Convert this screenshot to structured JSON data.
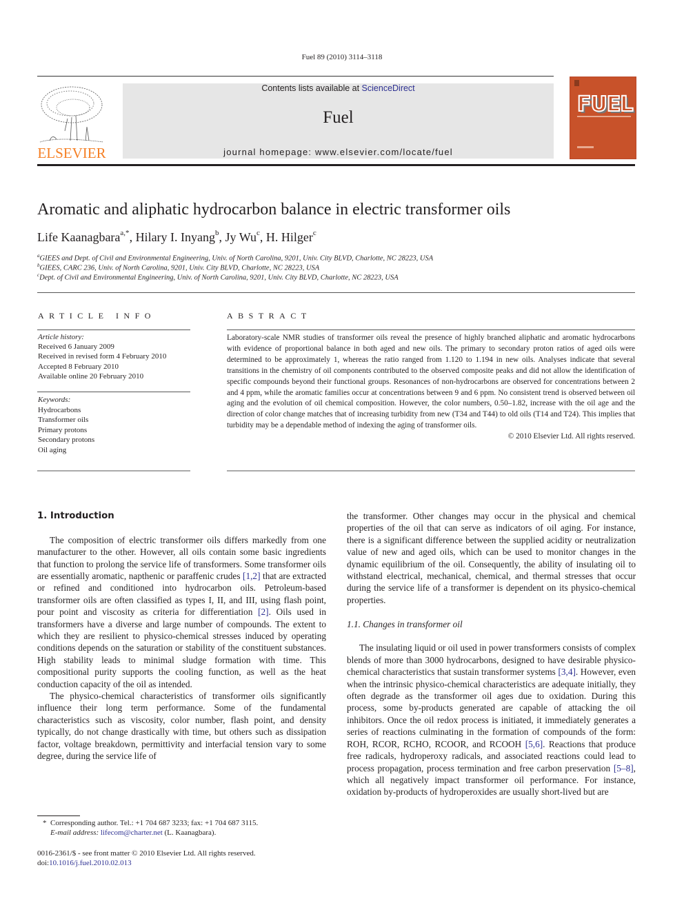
{
  "running_head": "Fuel 89 (2010) 3114–3118",
  "banner": {
    "contents_prefix": "Contents lists available at ",
    "contents_link": "ScienceDirect",
    "journal_title": "Fuel",
    "homepage": "journal homepage: www.elsevier.com/locate/fuel"
  },
  "publisher": {
    "logo_text": "ELSEVIER",
    "brand_color": "#f58025"
  },
  "cover": {
    "title": "FUEL",
    "color": "#c8522a"
  },
  "article": {
    "title": "Aromatic and aliphatic hydrocarbon balance in electric transformer oils",
    "authors": [
      {
        "name": "Life Kaanagbara",
        "sup": "a,*",
        "sep": ", "
      },
      {
        "name": "Hilary I. Inyang",
        "sup": "b",
        "sep": ", "
      },
      {
        "name": "Jy Wu",
        "sup": "c",
        "sep": ", "
      },
      {
        "name": "H. Hilger",
        "sup": "c",
        "sep": ""
      }
    ],
    "affiliations": [
      {
        "sup": "a",
        "text": "GIEES and Dept. of Civil and Environmental Engineering, Univ. of North Carolina, 9201, Univ. City BLVD, Charlotte, NC 28223, USA"
      },
      {
        "sup": "b",
        "text": "GIEES, CARC 236, Univ. of North Carolina, 9201, Univ. City BLVD, Charlotte, NC 28223, USA"
      },
      {
        "sup": "c",
        "text": "Dept. of Civil and Environmental Engineering, Univ. of North Carolina, 9201, Univ. City BLVD, Charlotte, NC 28223, USA"
      }
    ]
  },
  "article_info": {
    "heading": "ARTICLE INFO",
    "history_label": "Article history:",
    "history": [
      "Received 6 January 2009",
      "Received in revised form 4 February 2010",
      "Accepted 8 February 2010",
      "Available online 20 February 2010"
    ],
    "keywords_label": "Keywords:",
    "keywords": [
      "Hydrocarbons",
      "Transformer oils",
      "Primary protons",
      "Secondary protons",
      "Oil aging"
    ]
  },
  "abstract": {
    "heading": "ABSTRACT",
    "text": "Laboratory-scale NMR studies of transformer oils reveal the presence of highly branched aliphatic and aromatic hydrocarbons with evidence of proportional balance in both aged and new oils. The primary to secondary proton ratios of aged oils were determined to be approximately 1, whereas the ratio ranged from 1.120 to 1.194 in new oils. Analyses indicate that several transitions in the chemistry of oil components contributed to the observed composite peaks and did not allow the identification of specific compounds beyond their functional groups. Resonances of non-hydrocarbons are observed for concentrations between 2 and 4 ppm, while the aromatic families occur at concentrations between 9 and 6 ppm. No consistent trend is observed between oil aging and the evolution of oil chemical composition. However, the color numbers, 0.50–1.82, increase with the oil age and the direction of color change matches that of increasing turbidity from new (T34 and T44) to old oils (T14 and T24). This implies that turbidity may be a dependable method of indexing the aging of transformer oils.",
    "copyright": "© 2010 Elsevier Ltd. All rights reserved."
  },
  "body": {
    "intro_heading": "1. Introduction",
    "p1": [
      {
        "t": "The composition of electric transformer oils differs markedly from one manufacturer to the other. However, all oils contain some basic ingredients that function to prolong the service life of transformers. Some transformer oils are essentially aromatic, napthenic or paraffenic crudes "
      },
      {
        "ref": "[1,2]"
      },
      {
        "t": " that are extracted or refined and conditioned into hydrocarbon oils. Petroleum-based transformer oils are often classified as types I, II, and III, using flash point, pour point and viscosity as criteria for differentiation "
      },
      {
        "ref": "[2]"
      },
      {
        "t": ". Oils used in transformers have a diverse and large number of compounds. The extent to which they are resilient to physico-chemical stresses induced by operating conditions depends on the saturation or stability of the constituent substances. High stability leads to minimal sludge formation with time. This compositional purity supports the cooling function, as well as the heat conduction capacity of the oil as intended."
      }
    ],
    "p2": [
      {
        "t": "The physico-chemical characteristics of transformer oils significantly influence their long term performance. Some of the fundamental characteristics such as viscosity, color number, flash point, and density typically, do not change drastically with time, but others such as dissipation factor, voltage breakdown, permittivity and interfacial tension vary to some degree, during the service life of the transformer. Other changes may occur in the physical and chemical properties of the oil that can serve as indicators of oil aging. For instance, there is a significant difference between the supplied acidity or neutralization value of new and aged oils, which can be used to monitor changes in the dynamic equilibrium of the oil. Consequently, the ability of insulating oil to withstand electrical, mechanical, chemical, and thermal stresses that occur during the service life of a transformer is dependent on its physico-chemical properties."
      }
    ],
    "p2_left": "The physico-chemical characteristics of transformer oils significantly influence their long term performance. Some of the fundamental characteristics such as viscosity, color number, flash point, and density typically, do not change drastically with time, but others such as dissipation factor, voltage breakdown, permittivity and interfacial tension vary to some degree, during the service life of",
    "p2_right": "the transformer. Other changes may occur in the physical and chemical properties of the oil that can serve as indicators of oil aging. For instance, there is a significant difference between the supplied acidity or neutralization value of new and aged oils, which can be used to monitor changes in the dynamic equilibrium of the oil. Consequently, the ability of insulating oil to withstand electrical, mechanical, chemical, and thermal stresses that occur during the service life of a transformer is dependent on its physico-chemical properties.",
    "subsection_heading": "1.1. Changes in transformer oil",
    "p3": [
      {
        "t": "The insulating liquid or oil used in power transformers consists of complex blends of more than 3000 hydrocarbons, designed to have desirable physico-chemical characteristics that sustain transformer systems "
      },
      {
        "ref": "[3,4]"
      },
      {
        "t": ". However, even when the intrinsic physico-chemical characteristics are adequate initially, they often degrade as the transformer oil ages due to oxidation. During this process, some by-products generated are capable of attacking the oil inhibitors. Once the oil redox process is initiated, it immediately generates a series of reactions culminating in the formation of compounds of the form: ROH, RCOR, RCHO, RCOOR, and RCOOH "
      },
      {
        "ref": "[5,6]"
      },
      {
        "t": ". Reactions that produce free radicals, hydroperoxy radicals, and associated reactions could lead to process propagation, process termination and free carbon preservation "
      },
      {
        "ref": "[5–8]"
      },
      {
        "t": ", which all negatively impact transformer oil performance. For instance, oxidation by-products of hydroperoxides are usually short-lived but are"
      }
    ]
  },
  "footnote": {
    "marker": "*",
    "corresponding": "Corresponding author. Tel.: +1 704 687 3233; fax: +1 704 687 3115.",
    "email_label": "E-mail address:",
    "email": "lifecom@charter.net",
    "email_suffix": " (L. Kaanagbara)."
  },
  "frontmatter": {
    "issn_line": "0016-2361/$ - see front matter © 2010 Elsevier Ltd. All rights reserved.",
    "doi_prefix": "doi:",
    "doi": "10.1016/j.fuel.2010.02.013"
  }
}
